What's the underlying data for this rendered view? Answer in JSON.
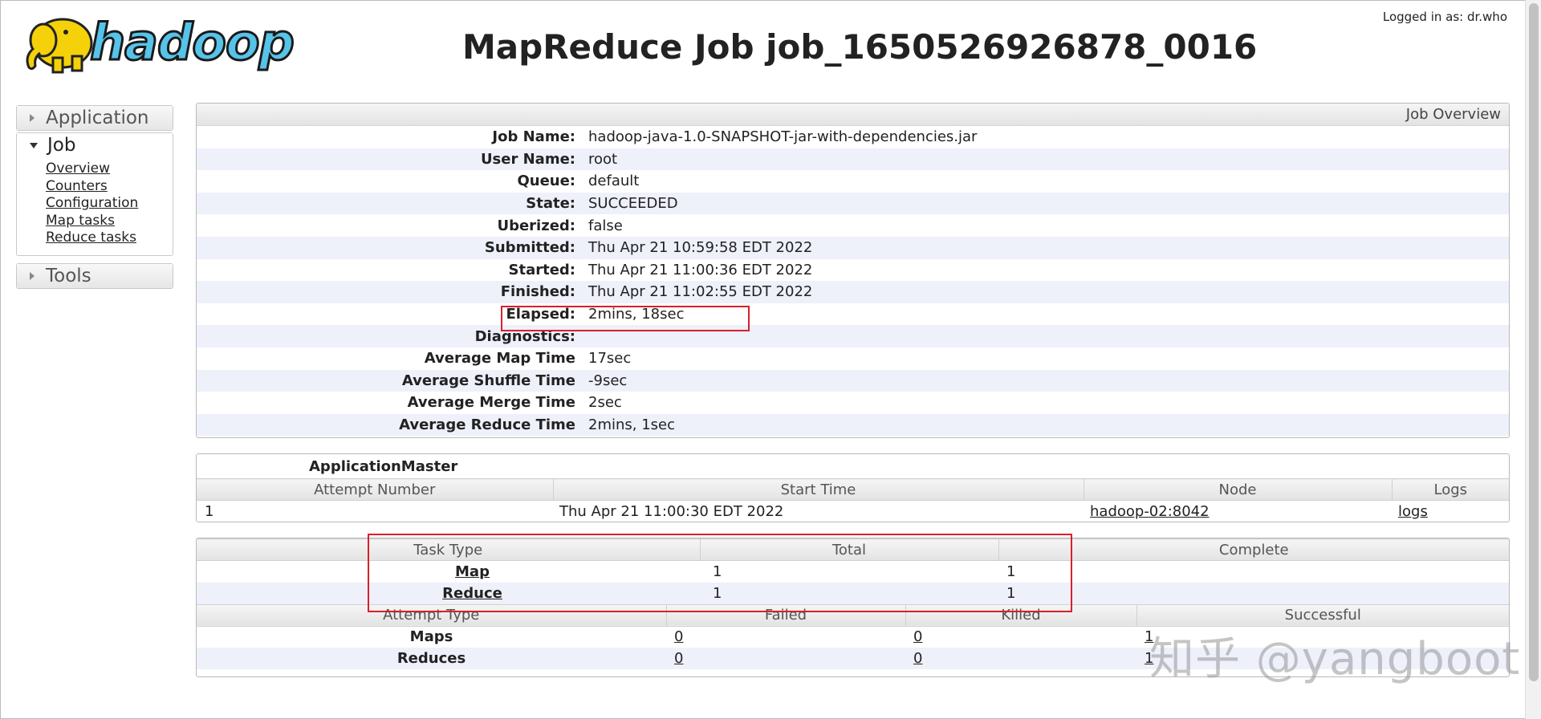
{
  "header": {
    "logo_text": "hadoop",
    "title": "MapReduce Job job_1650526926878_0016",
    "logged_in": "Logged in as: dr.who"
  },
  "sidebar": {
    "application_label": "Application",
    "job_label": "Job",
    "job_links": [
      "Overview",
      "Counters",
      "Configuration",
      "Map tasks",
      "Reduce tasks"
    ],
    "tools_label": "Tools"
  },
  "overview": {
    "header": "Job Overview",
    "rows": [
      {
        "k": "Job Name:",
        "v": "hadoop-java-1.0-SNAPSHOT-jar-with-dependencies.jar"
      },
      {
        "k": "User Name:",
        "v": "root"
      },
      {
        "k": "Queue:",
        "v": "default"
      },
      {
        "k": "State:",
        "v": "SUCCEEDED"
      },
      {
        "k": "Uberized:",
        "v": "false"
      },
      {
        "k": "Submitted:",
        "v": "Thu Apr 21 10:59:58 EDT 2022"
      },
      {
        "k": "Started:",
        "v": "Thu Apr 21 11:00:36 EDT 2022"
      },
      {
        "k": "Finished:",
        "v": "Thu Apr 21 11:02:55 EDT 2022"
      },
      {
        "k": "Elapsed:",
        "v": "2mins, 18sec"
      },
      {
        "k": "Diagnostics:",
        "v": ""
      },
      {
        "k": "Average Map Time",
        "v": "17sec"
      },
      {
        "k": "Average Shuffle Time",
        "v": "-9sec"
      },
      {
        "k": "Average Merge Time",
        "v": "2sec"
      },
      {
        "k": "Average Reduce Time",
        "v": "2mins, 1sec"
      }
    ]
  },
  "app_master": {
    "caption": "ApplicationMaster",
    "headers": [
      "Attempt Number",
      "Start Time",
      "Node",
      "Logs"
    ],
    "row": {
      "attempt": "1",
      "start_time": "Thu Apr 21 11:00:30 EDT 2022",
      "node": "hadoop-02:8042",
      "logs": "logs"
    }
  },
  "tasks": {
    "headers": [
      "Task Type",
      "Total",
      "Complete"
    ],
    "rows": [
      {
        "type": "Map",
        "total": "1",
        "complete": "1"
      },
      {
        "type": "Reduce",
        "total": "1",
        "complete": "1"
      }
    ]
  },
  "attempts": {
    "headers": [
      "Attempt Type",
      "Failed",
      "Killed",
      "Successful"
    ],
    "rows": [
      {
        "type": "Maps",
        "failed": "0",
        "killed": "0",
        "successful": "1"
      },
      {
        "type": "Reduces",
        "failed": "0",
        "killed": "0",
        "successful": "1"
      }
    ]
  },
  "watermark": "知乎 @yangboot",
  "colors": {
    "highlight_box": "#d9202a",
    "alt_row": "#eef0fa",
    "logo_yellow": "#f5d10a",
    "logo_blue": "#56c3e9"
  }
}
